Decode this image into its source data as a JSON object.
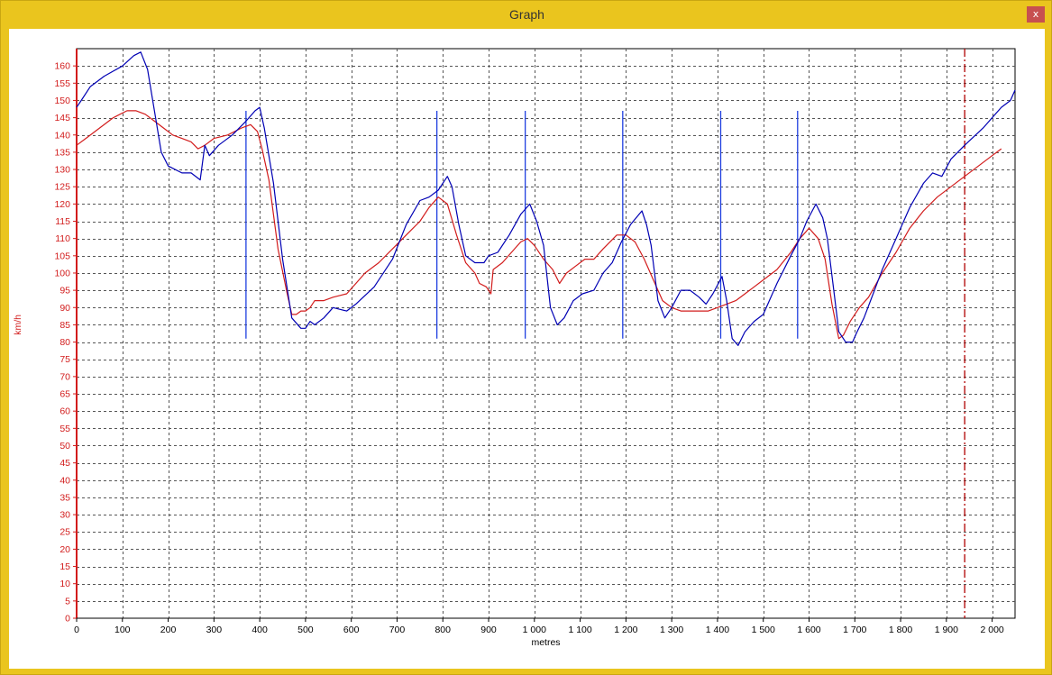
{
  "window": {
    "title": "Graph",
    "close_label": "x"
  },
  "colors": {
    "series_a": "#0000b4",
    "series_b": "#d21c1c",
    "markers": "#1f3fe0",
    "ref_line": "#b00000",
    "y_axis": "#d21c1c",
    "grid": "#555555"
  },
  "chart_data": {
    "type": "line",
    "xlabel": "metres",
    "ylabel": "km/h",
    "xlim": [
      0,
      2050
    ],
    "ylim": [
      0,
      165
    ],
    "x_ticks": [
      0,
      100,
      200,
      300,
      400,
      500,
      600,
      700,
      800,
      900,
      1000,
      1100,
      1200,
      1300,
      1400,
      1500,
      1600,
      1700,
      1800,
      1900,
      2000
    ],
    "x_tick_labels": [
      "0",
      "100",
      "200",
      "300",
      "400",
      "500",
      "600",
      "700",
      "800",
      "900",
      "1 000",
      "1 100",
      "1 200",
      "1 300",
      "1 400",
      "1 500",
      "1 600",
      "1 700",
      "1 800",
      "1 900",
      "2 000"
    ],
    "y_ticks": [
      0,
      5,
      10,
      15,
      20,
      25,
      30,
      35,
      40,
      45,
      50,
      55,
      60,
      65,
      70,
      75,
      80,
      85,
      90,
      95,
      100,
      105,
      110,
      115,
      120,
      125,
      130,
      135,
      140,
      145,
      150,
      155,
      160
    ],
    "grid": true,
    "series": [
      {
        "color_key": "series_a",
        "points": [
          [
            0,
            148
          ],
          [
            10,
            150
          ],
          [
            30,
            154
          ],
          [
            60,
            157
          ],
          [
            100,
            160
          ],
          [
            125,
            163
          ],
          [
            140,
            164
          ],
          [
            155,
            159
          ],
          [
            170,
            147
          ],
          [
            185,
            135
          ],
          [
            200,
            131
          ],
          [
            230,
            129
          ],
          [
            250,
            129
          ],
          [
            270,
            127
          ],
          [
            280,
            137
          ],
          [
            290,
            134
          ],
          [
            310,
            137
          ],
          [
            340,
            140
          ],
          [
            370,
            144
          ],
          [
            390,
            147
          ],
          [
            400,
            148
          ],
          [
            410,
            142
          ],
          [
            430,
            126
          ],
          [
            450,
            104
          ],
          [
            470,
            87
          ],
          [
            490,
            84
          ],
          [
            500,
            84
          ],
          [
            510,
            86
          ],
          [
            520,
            85
          ],
          [
            540,
            87
          ],
          [
            560,
            90
          ],
          [
            590,
            89
          ],
          [
            610,
            91
          ],
          [
            650,
            96
          ],
          [
            690,
            104
          ],
          [
            720,
            114
          ],
          [
            750,
            121
          ],
          [
            770,
            122
          ],
          [
            790,
            124
          ],
          [
            810,
            128
          ],
          [
            820,
            125
          ],
          [
            835,
            114
          ],
          [
            850,
            105
          ],
          [
            870,
            103
          ],
          [
            890,
            103
          ],
          [
            900,
            105
          ],
          [
            920,
            106
          ],
          [
            945,
            111
          ],
          [
            970,
            117
          ],
          [
            990,
            120
          ],
          [
            1005,
            115
          ],
          [
            1020,
            108
          ],
          [
            1035,
            90
          ],
          [
            1050,
            85
          ],
          [
            1065,
            87
          ],
          [
            1085,
            92
          ],
          [
            1105,
            94
          ],
          [
            1130,
            95
          ],
          [
            1150,
            100
          ],
          [
            1170,
            103
          ],
          [
            1190,
            109
          ],
          [
            1210,
            114
          ],
          [
            1235,
            118
          ],
          [
            1245,
            114
          ],
          [
            1255,
            108
          ],
          [
            1270,
            92
          ],
          [
            1285,
            87
          ],
          [
            1300,
            90
          ],
          [
            1320,
            95
          ],
          [
            1340,
            95
          ],
          [
            1360,
            93
          ],
          [
            1375,
            91
          ],
          [
            1390,
            94
          ],
          [
            1410,
            99
          ],
          [
            1420,
            92
          ],
          [
            1432,
            81
          ],
          [
            1445,
            79
          ],
          [
            1460,
            83
          ],
          [
            1480,
            86
          ],
          [
            1500,
            88
          ],
          [
            1530,
            97
          ],
          [
            1560,
            105
          ],
          [
            1580,
            110
          ],
          [
            1595,
            115
          ],
          [
            1615,
            120
          ],
          [
            1630,
            116
          ],
          [
            1640,
            110
          ],
          [
            1655,
            94
          ],
          [
            1665,
            83
          ],
          [
            1680,
            80
          ],
          [
            1695,
            80
          ],
          [
            1705,
            83
          ],
          [
            1720,
            87
          ],
          [
            1740,
            94
          ],
          [
            1760,
            101
          ],
          [
            1790,
            110
          ],
          [
            1820,
            119
          ],
          [
            1850,
            126
          ],
          [
            1870,
            129
          ],
          [
            1890,
            128
          ],
          [
            1910,
            133
          ],
          [
            1940,
            137
          ],
          [
            1980,
            142
          ],
          [
            2020,
            148
          ],
          [
            2040,
            150
          ],
          [
            2050,
            153
          ]
        ]
      },
      {
        "color_key": "series_b",
        "points": [
          [
            0,
            137
          ],
          [
            20,
            139
          ],
          [
            50,
            142
          ],
          [
            80,
            145
          ],
          [
            110,
            147
          ],
          [
            130,
            147
          ],
          [
            150,
            146
          ],
          [
            170,
            144
          ],
          [
            190,
            142
          ],
          [
            210,
            140
          ],
          [
            230,
            139
          ],
          [
            250,
            138
          ],
          [
            265,
            136
          ],
          [
            280,
            137
          ],
          [
            300,
            139
          ],
          [
            330,
            140
          ],
          [
            360,
            142
          ],
          [
            380,
            143
          ],
          [
            395,
            141
          ],
          [
            405,
            136
          ],
          [
            420,
            127
          ],
          [
            440,
            107
          ],
          [
            460,
            94
          ],
          [
            470,
            88
          ],
          [
            480,
            88
          ],
          [
            490,
            89
          ],
          [
            500,
            89
          ],
          [
            510,
            90
          ],
          [
            520,
            92
          ],
          [
            540,
            92
          ],
          [
            560,
            93
          ],
          [
            590,
            94
          ],
          [
            610,
            97
          ],
          [
            630,
            100
          ],
          [
            660,
            103
          ],
          [
            690,
            107
          ],
          [
            720,
            111
          ],
          [
            750,
            115
          ],
          [
            770,
            119
          ],
          [
            790,
            122
          ],
          [
            810,
            120
          ],
          [
            830,
            111
          ],
          [
            850,
            103
          ],
          [
            870,
            100
          ],
          [
            880,
            97
          ],
          [
            895,
            96
          ],
          [
            905,
            94
          ],
          [
            910,
            101
          ],
          [
            930,
            103
          ],
          [
            950,
            106
          ],
          [
            970,
            109
          ],
          [
            985,
            110
          ],
          [
            1000,
            108
          ],
          [
            1020,
            104
          ],
          [
            1040,
            101
          ],
          [
            1055,
            97
          ],
          [
            1070,
            100
          ],
          [
            1090,
            102
          ],
          [
            1110,
            104
          ],
          [
            1130,
            104
          ],
          [
            1150,
            107
          ],
          [
            1180,
            111
          ],
          [
            1200,
            111
          ],
          [
            1220,
            109
          ],
          [
            1240,
            104
          ],
          [
            1260,
            98
          ],
          [
            1280,
            92
          ],
          [
            1300,
            90
          ],
          [
            1320,
            89
          ],
          [
            1340,
            89
          ],
          [
            1360,
            89
          ],
          [
            1380,
            89
          ],
          [
            1400,
            90
          ],
          [
            1420,
            91
          ],
          [
            1440,
            92
          ],
          [
            1460,
            94
          ],
          [
            1480,
            96
          ],
          [
            1500,
            98
          ],
          [
            1530,
            101
          ],
          [
            1560,
            106
          ],
          [
            1580,
            110
          ],
          [
            1600,
            113
          ],
          [
            1620,
            110
          ],
          [
            1635,
            104
          ],
          [
            1650,
            91
          ],
          [
            1665,
            81
          ],
          [
            1675,
            82
          ],
          [
            1690,
            86
          ],
          [
            1710,
            90
          ],
          [
            1730,
            93
          ],
          [
            1760,
            100
          ],
          [
            1790,
            106
          ],
          [
            1820,
            113
          ],
          [
            1850,
            118
          ],
          [
            1880,
            122
          ],
          [
            1910,
            125
          ],
          [
            1940,
            128
          ],
          [
            1970,
            131
          ],
          [
            2000,
            134
          ],
          [
            2020,
            136
          ]
        ]
      }
    ],
    "markers": {
      "x": [
        370,
        787,
        980,
        1193,
        1407,
        1575
      ],
      "y_range": [
        81,
        147
      ]
    },
    "reference_line": {
      "x": 1940,
      "style": "dash-dot"
    }
  }
}
